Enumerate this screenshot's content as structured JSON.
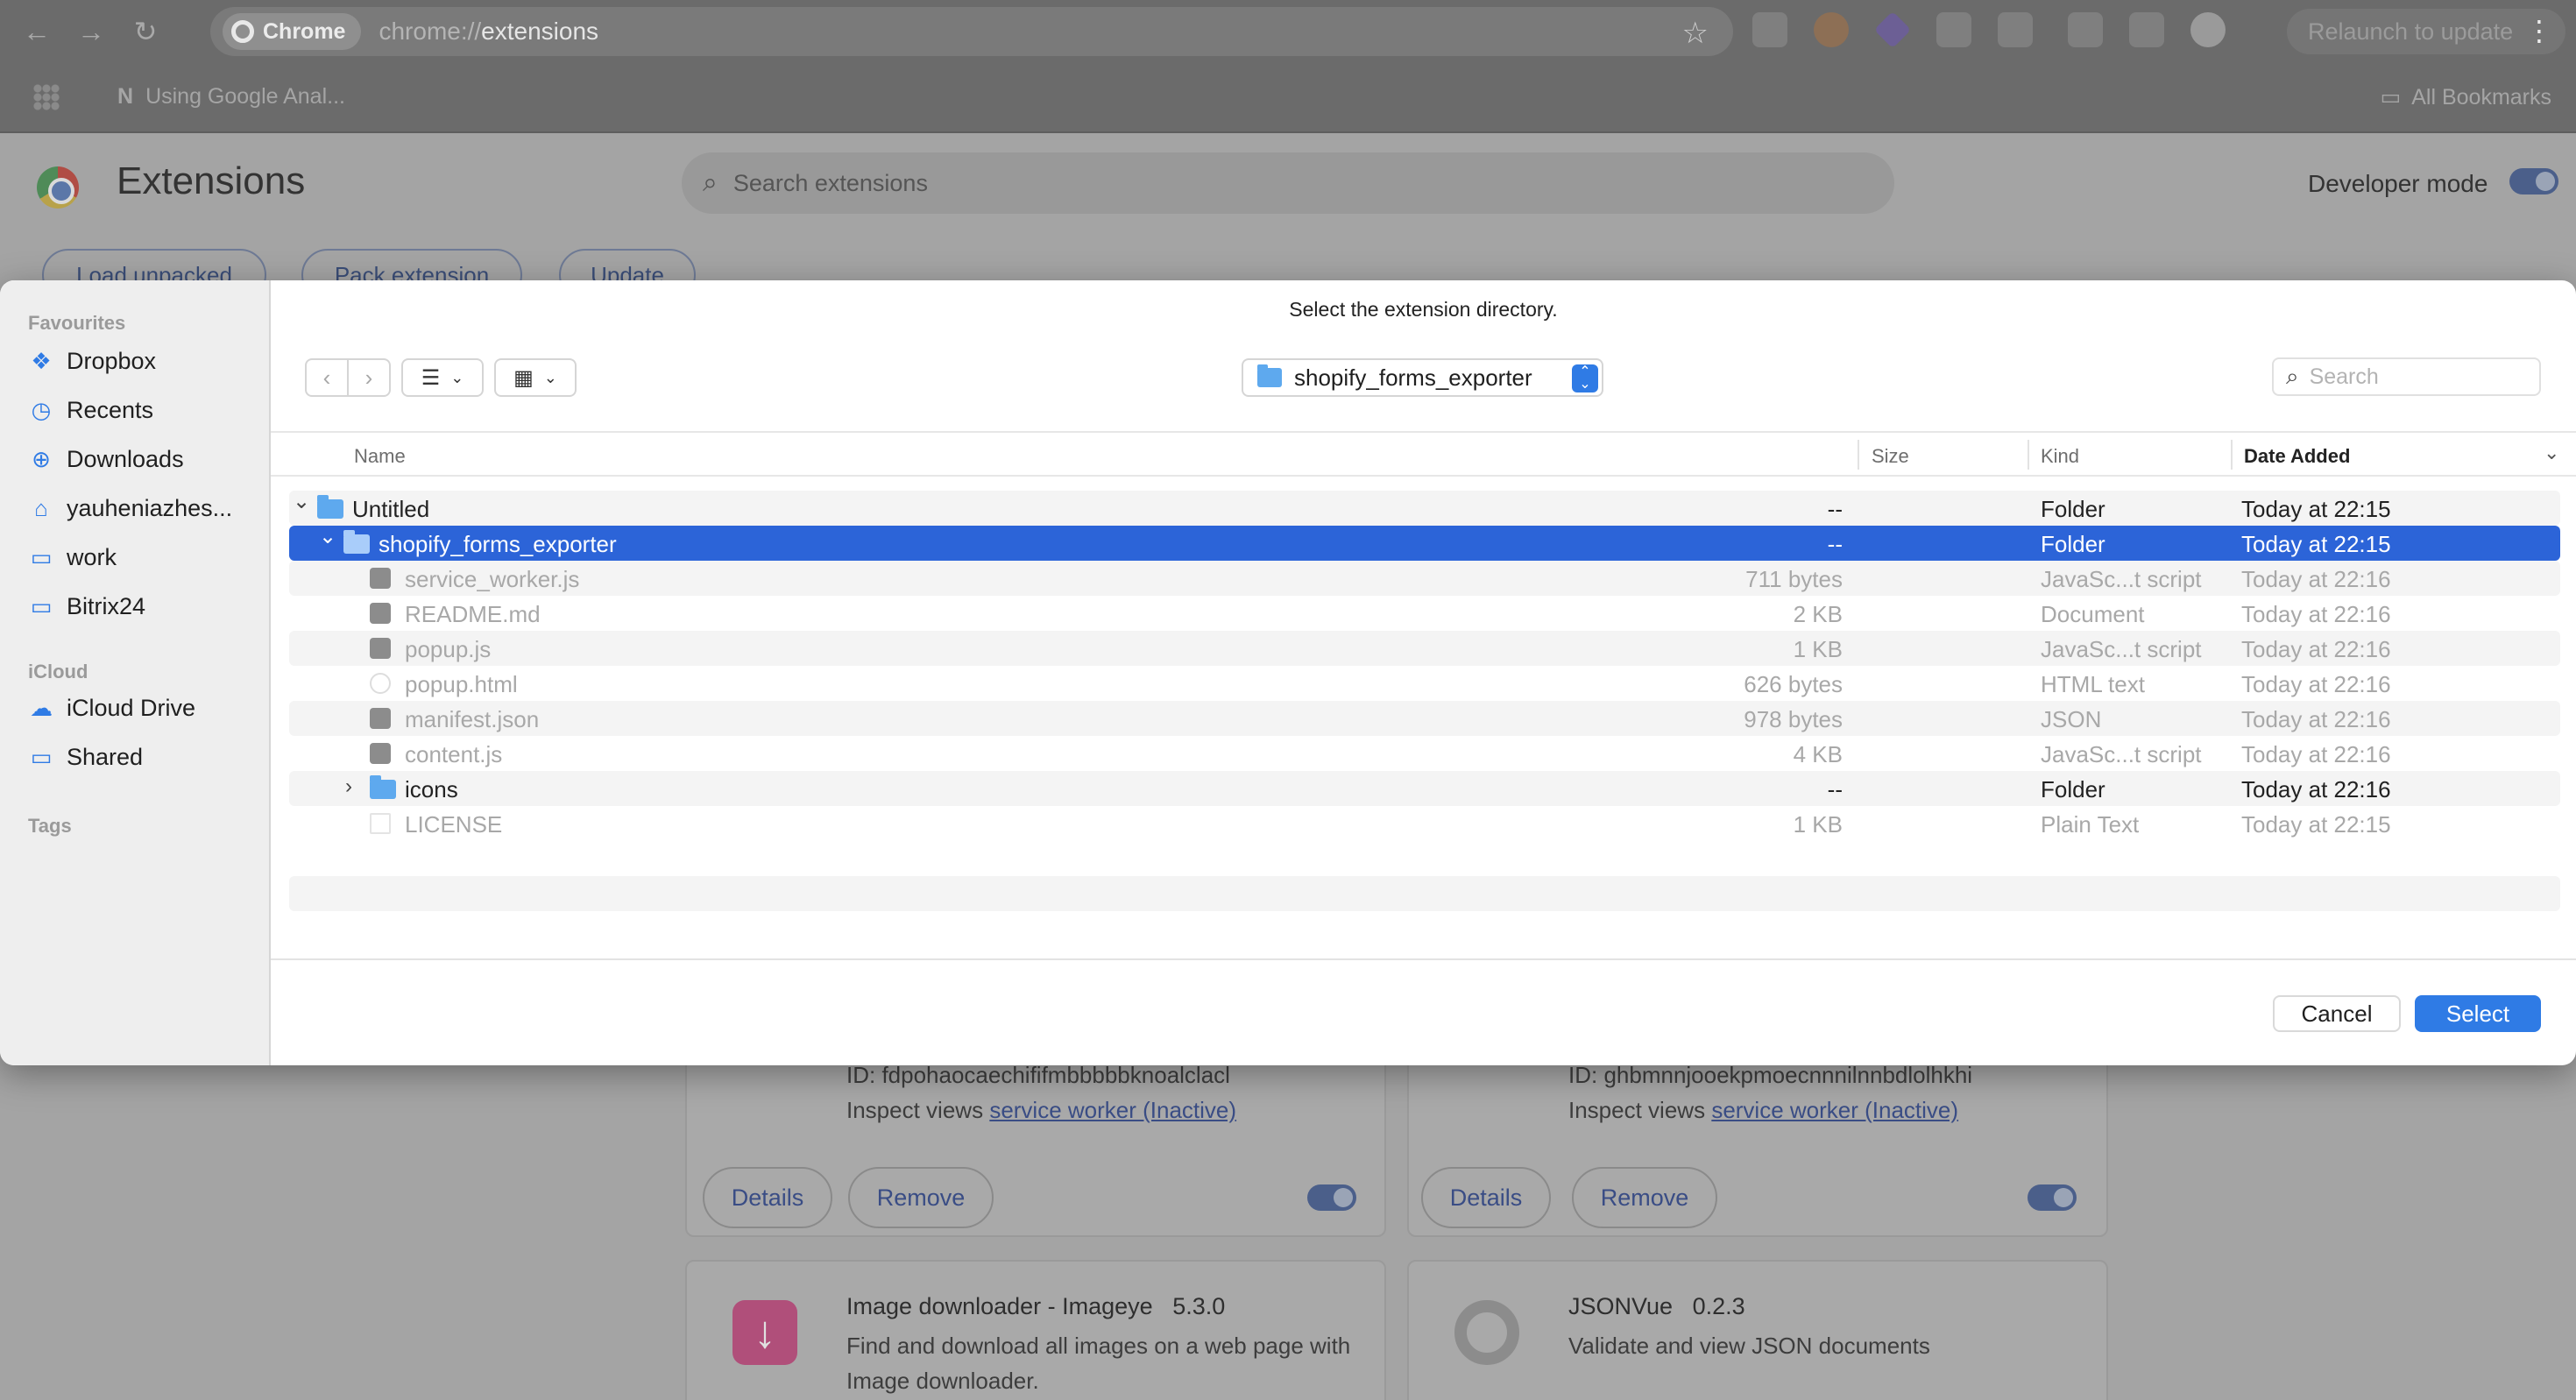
{
  "browser": {
    "chip_label": "Chrome",
    "url_scheme": "chrome://",
    "url_path": "extensions",
    "relaunch_label": "Relaunch to update",
    "bookmark_item": "Using Google Anal...",
    "all_bookmarks": "All Bookmarks"
  },
  "extensions_page": {
    "title": "Extensions",
    "search_placeholder": "Search extensions",
    "developer_mode_label": "Developer mode",
    "toolbar_buttons": [
      "Load unpacked",
      "Pack extension",
      "Update"
    ],
    "cards": [
      {
        "id_text": "ID: fdpohaocaechififmbbbbbknoalclacl",
        "inspect_label": "Inspect views",
        "inspect_link": "service worker (Inactive)",
        "details": "Details",
        "remove": "Remove"
      },
      {
        "id_text": "ID: ghbmnnjooekpmoecnnnilnnbdlolhkhi",
        "inspect_label": "Inspect views",
        "inspect_link": "service worker (Inactive)",
        "details": "Details",
        "remove": "Remove"
      },
      {
        "name": "Image downloader - Imageye",
        "version": "5.3.0",
        "description": "Find and download all images on a web page with Image downloader."
      },
      {
        "name": "JSONVue",
        "version": "0.2.3",
        "description": "Validate and view JSON documents"
      }
    ]
  },
  "dialog": {
    "title": "Select the extension directory.",
    "location": "shopify_forms_exporter",
    "search_placeholder": "Search",
    "sidebar": {
      "favourites_heading": "Favourites",
      "favourites": [
        {
          "label": "Dropbox",
          "icon": "dropbox-icon"
        },
        {
          "label": "Recents",
          "icon": "clock-icon"
        },
        {
          "label": "Downloads",
          "icon": "download-icon"
        },
        {
          "label": "yauheniazhes...",
          "icon": "home-icon"
        },
        {
          "label": "work",
          "icon": "folder-icon"
        },
        {
          "label": "Bitrix24",
          "icon": "folder-icon"
        }
      ],
      "icloud_heading": "iCloud",
      "icloud": [
        {
          "label": "iCloud Drive",
          "icon": "cloud-icon"
        },
        {
          "label": "Shared",
          "icon": "shared-folder-icon"
        }
      ],
      "tags_heading": "Tags"
    },
    "columns": {
      "name": "Name",
      "size": "Size",
      "kind": "Kind",
      "date_added": "Date Added"
    },
    "rows": [
      {
        "name": "Untitled",
        "size": "--",
        "kind": "Folder",
        "date": "Today at 22:15",
        "type": "folder",
        "level": 0,
        "expanded": true
      },
      {
        "name": "shopify_forms_exporter",
        "size": "--",
        "kind": "Folder",
        "date": "Today at 22:15",
        "type": "folder",
        "level": 1,
        "expanded": true,
        "selected": true
      },
      {
        "name": "service_worker.js",
        "size": "711 bytes",
        "kind": "JavaSc...t script",
        "date": "Today at 22:16",
        "type": "file",
        "level": 2
      },
      {
        "name": "README.md",
        "size": "2 KB",
        "kind": "Document",
        "date": "Today at 22:16",
        "type": "file",
        "level": 2
      },
      {
        "name": "popup.js",
        "size": "1 KB",
        "kind": "JavaSc...t script",
        "date": "Today at 22:16",
        "type": "file",
        "level": 2
      },
      {
        "name": "popup.html",
        "size": "626 bytes",
        "kind": "HTML text",
        "date": "Today at 22:16",
        "type": "html",
        "level": 2
      },
      {
        "name": "manifest.json",
        "size": "978 bytes",
        "kind": "JSON",
        "date": "Today at 22:16",
        "type": "file",
        "level": 2
      },
      {
        "name": "content.js",
        "size": "4 KB",
        "kind": "JavaSc...t script",
        "date": "Today at 22:16",
        "type": "file",
        "level": 2
      },
      {
        "name": "icons",
        "size": "--",
        "kind": "Folder",
        "date": "Today at 22:16",
        "type": "folder",
        "level": 2,
        "expanded": false
      },
      {
        "name": "LICENSE",
        "size": "1 KB",
        "kind": "Plain Text",
        "date": "Today at 22:15",
        "type": "plain",
        "level": 2
      }
    ],
    "cancel_label": "Cancel",
    "select_label": "Select"
  },
  "colors": {
    "accent": "#2f7be5",
    "selection": "#2c64d8",
    "folder": "#5ea9ee"
  }
}
